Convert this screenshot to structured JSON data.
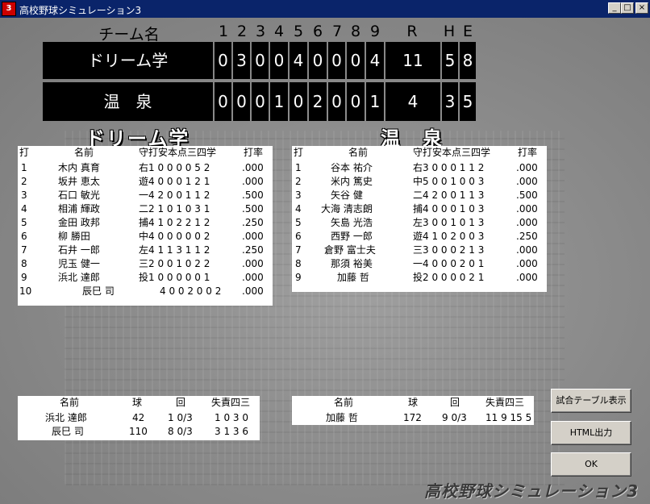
{
  "window": {
    "title": "高校野球シミュレーション3",
    "icon_text": "3",
    "btn_min": "_",
    "btn_max": "□",
    "btn_close": "×"
  },
  "scoreboard": {
    "header": {
      "team_col": "チーム名",
      "innings": [
        "1",
        "2",
        "3",
        "4",
        "5",
        "6",
        "7",
        "8",
        "9"
      ],
      "r": "R",
      "h": "H",
      "e": "E"
    },
    "teams": [
      {
        "name": "ドリーム学",
        "innings": [
          "0",
          "3",
          "0",
          "0",
          "4",
          "0",
          "0",
          "0",
          "4"
        ],
        "r": "11",
        "h": "5",
        "e": "8"
      },
      {
        "name": "温　泉",
        "innings": [
          "0",
          "0",
          "0",
          "1",
          "0",
          "2",
          "0",
          "0",
          "1"
        ],
        "r": "4",
        "h": "3",
        "e": "5"
      }
    ]
  },
  "home_title": "ドリーム学",
  "away_title": "温　泉",
  "batting_header": {
    "order": "打",
    "name": "名前",
    "stats": "守打安本点三四学",
    "avg": "打率"
  },
  "home_batting": [
    {
      "order": "1",
      "name": "木内 真育",
      "stats": "右1 0 0 0 0 5 2",
      "avg": ".000"
    },
    {
      "order": "2",
      "name": "坂井 恵太",
      "stats": "遊4 0 0 0 1 2 1",
      "avg": ".000"
    },
    {
      "order": "3",
      "name": "石口 敏光",
      "stats": "一4 2 0 0 1 1 2",
      "avg": ".500"
    },
    {
      "order": "4",
      "name": "相浦 輝政",
      "stats": "二2 1 0 1 0 3 1",
      "avg": ".500"
    },
    {
      "order": "5",
      "name": "金田 政邦",
      "stats": "捕4 1 0 2 2 1 2",
      "avg": ".250"
    },
    {
      "order": "6",
      "name": "柳 勝田",
      "stats": "中4 0 0 0 0 0 2",
      "avg": ".000"
    },
    {
      "order": "7",
      "name": "石井 一郎",
      "stats": "左4 1 1 3 1 1 2",
      "avg": ".250"
    },
    {
      "order": "8",
      "name": "児玉 健一",
      "stats": "三2 0 0 1 0 2 2",
      "avg": ".000"
    },
    {
      "order": "9",
      "name": "浜北 達郎",
      "stats": "投1 0 0 0 0 0 1",
      "avg": ".000"
    },
    {
      "order": "10",
      "name": "辰巳 司",
      "stats": "4 0 0 2 0 0 2",
      "avg": ".000"
    }
  ],
  "away_batting": [
    {
      "order": "1",
      "name": "谷本 祐介",
      "stats": "右3 0 0 0 1 1 2",
      "avg": ".000"
    },
    {
      "order": "2",
      "name": "米内 篤史",
      "stats": "中5 0 0 1 0 0 3",
      "avg": ".000"
    },
    {
      "order": "3",
      "name": "矢谷 健",
      "stats": "二4 2 0 0 1 1 3",
      "avg": ".500"
    },
    {
      "order": "4",
      "name": "大海 清志朗",
      "stats": "捕4 0 0 0 1 0 3",
      "avg": ".000"
    },
    {
      "order": "5",
      "name": "矢島 光浩",
      "stats": "左3 0 0 1 0 1 3",
      "avg": ".000"
    },
    {
      "order": "6",
      "name": "西野 一郎",
      "stats": "遊4 1 0 2 0 0 3",
      "avg": ".250"
    },
    {
      "order": "7",
      "name": "倉野 富士夫",
      "stats": "三3 0 0 0 2 1 3",
      "avg": ".000"
    },
    {
      "order": "8",
      "name": "那須 裕美",
      "stats": "一4 0 0 0 2 0 1",
      "avg": ".000"
    },
    {
      "order": "9",
      "name": "加藤 哲",
      "stats": "投2 0 0 0 0 2 1",
      "avg": ".000"
    }
  ],
  "pitching_header": {
    "name": "名前",
    "pitches": "球",
    "innings": "回",
    "stats": "失責四三"
  },
  "home_pitching": [
    {
      "name": "浜北 達郎",
      "pitches": "42",
      "innings": "1 0/3",
      "stats": "1 0 3 0"
    },
    {
      "name": "辰巳 司",
      "pitches": "110",
      "innings": "8 0/3",
      "stats": "3 1 3 6"
    }
  ],
  "away_pitching": [
    {
      "name": "加藤 哲",
      "pitches": "172",
      "innings": "9 0/3",
      "stats": "11 9 15 5"
    }
  ],
  "buttons": {
    "table": "試合テーブル表示",
    "html": "HTML出力",
    "ok": "OK"
  },
  "watermark": "高校野球シミュレーション3"
}
